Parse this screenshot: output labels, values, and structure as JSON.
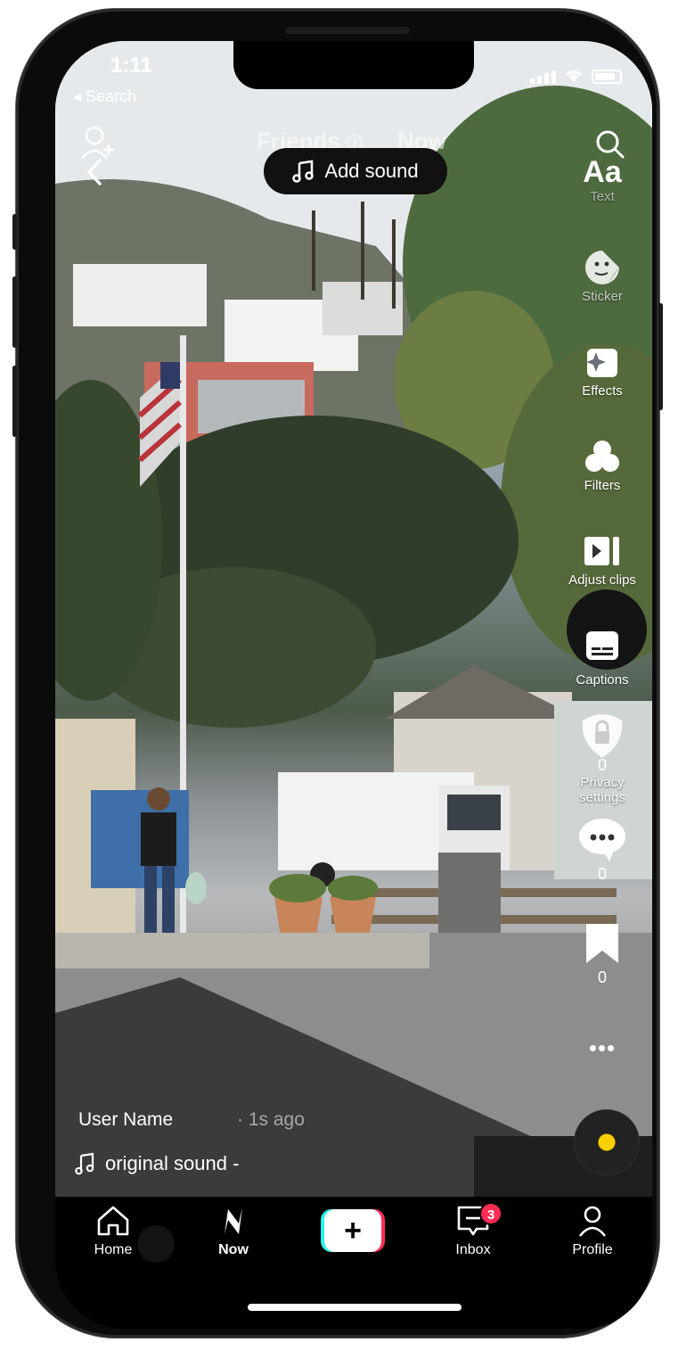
{
  "status_bar": {
    "time": "1:11",
    "back_label": "◂ Search"
  },
  "top_tabs": [
    {
      "label": "Friends"
    },
    {
      "label": "Now"
    }
  ],
  "add_sound": {
    "label": "Add sound"
  },
  "right_rail": {
    "text_icon_glyph": "Aa",
    "text_label": "Text",
    "sticker_label": "Sticker",
    "effects_label": "Effects",
    "filters_label": "Filters",
    "adjust_clips_label": "Adjust clips",
    "captions_label": "Captions",
    "privacy_label_line1": "Privacy",
    "privacy_label_line2": "settings",
    "privacy_count": "0",
    "comments_count": "0",
    "bookmarks_count": "0",
    "more_label": "•••"
  },
  "post": {
    "user_name": "User Name",
    "time_ago": "· 1s ago",
    "sound": "original sound -"
  },
  "bottom_nav": {
    "items": [
      {
        "label": "Home",
        "icon": "home-icon"
      },
      {
        "label": "Now",
        "icon": "now-icon"
      },
      {
        "label": "",
        "icon": "create-icon"
      },
      {
        "label": "Inbox",
        "icon": "inbox-icon"
      },
      {
        "label": "Profile",
        "icon": "profile-icon"
      }
    ],
    "inbox_badge": "3"
  },
  "colors": {
    "accent_red": "#fe2c55",
    "accent_cyan": "#25f4ee",
    "disc_center": "#ffd000"
  }
}
